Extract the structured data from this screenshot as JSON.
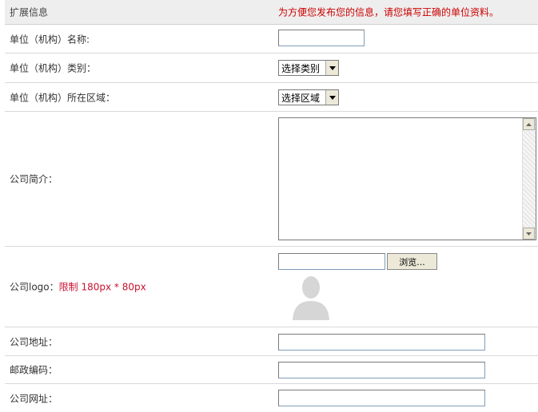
{
  "header": {
    "title": "扩展信息",
    "notice": "为方便您发布您的信息，请您填写正确的单位资料。"
  },
  "fields": {
    "org_name_label": "单位（机构）名称:",
    "org_type_label": "单位（机构）类别：",
    "org_type_selected": "选择类别",
    "org_region_label": "单位（机构）所在区域：",
    "org_region_selected": "选择区域",
    "intro_label": "公司简介：",
    "logo_label_prefix": "公司logo：",
    "logo_limit": "限制  180px * 80px",
    "browse_label": "浏览...",
    "address_label": "公司地址：",
    "postcode_label": "邮政编码：",
    "website_label": "公司网址："
  },
  "icons": {
    "select_arrow": "chevron-down-icon",
    "scroll_up": "scroll-up-icon",
    "scroll_down": "scroll-down-icon",
    "logo_placeholder": "person-silhouette-icon"
  },
  "colors": {
    "notice": "#cc0000",
    "limit": "#c8102e",
    "header_bg": "#eeeeee"
  }
}
